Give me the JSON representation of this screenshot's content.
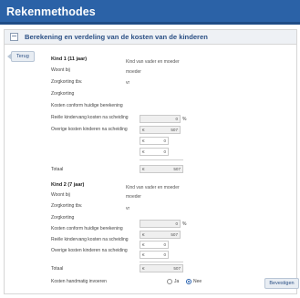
{
  "app": {
    "title": "Rekenmethodes"
  },
  "section": {
    "title": "Berekening en verdeling van de kosten van de kinderen",
    "toggle_symbol": "−"
  },
  "back_button": "Terug",
  "children": [
    {
      "heading": "Kind 1 (11 jaar)",
      "heading_value": "Kind van vader en moeder",
      "rows": {
        "woont_bij": {
          "label": "Woont bij",
          "value": "moeder"
        },
        "zorgkorting_tbv": {
          "label": "Zorgkorting tbv.",
          "value": "vr"
        },
        "zorgkorting": {
          "label": "Zorgkorting",
          "value": "0",
          "unit": "%"
        },
        "kosten_conform": {
          "label": "Kosten conform huidige berekening",
          "currency": "€",
          "value": "507"
        },
        "reele_kosten": {
          "label": "Reële kindervang kosten na scheiding",
          "currency": "€",
          "value": "0"
        },
        "overige_kosten": {
          "label": "Overige kosten kinderen na scheiding",
          "currency": "€",
          "value": "0"
        },
        "totaal": {
          "label": "Totaal",
          "currency": "€",
          "value": "507"
        }
      }
    },
    {
      "heading": "Kind 2 (7 jaar)",
      "heading_value": "Kind van vader en moeder",
      "rows": {
        "woont_bij": {
          "label": "Woont bij",
          "value": "moeder"
        },
        "zorgkorting_tbv": {
          "label": "Zorgkorting tbv.",
          "value": "vr"
        },
        "zorgkorting": {
          "label": "Zorgkorting",
          "value": "0",
          "unit": "%"
        },
        "kosten_conform": {
          "label": "Kosten conform huidige berekening",
          "currency": "€",
          "value": "507"
        },
        "reele_kosten": {
          "label": "Reële kindervang kosten na scheiding",
          "currency": "€",
          "value": "0"
        },
        "overige_kosten": {
          "label": "Overige kosten kinderen na scheiding",
          "currency": "€",
          "value": "0"
        },
        "totaal": {
          "label": "Totaal",
          "currency": "€",
          "value": "507"
        }
      }
    }
  ],
  "handmatig": {
    "label": "Kosten handmatig invoeren",
    "option_ja": "Ja",
    "option_nee": "Nee",
    "selected": "Nee"
  },
  "save_button": "Bevestigen",
  "colors": {
    "accent": "#2b62a7",
    "title_text": "#ffffff",
    "link_blue": "#2a4f84"
  }
}
